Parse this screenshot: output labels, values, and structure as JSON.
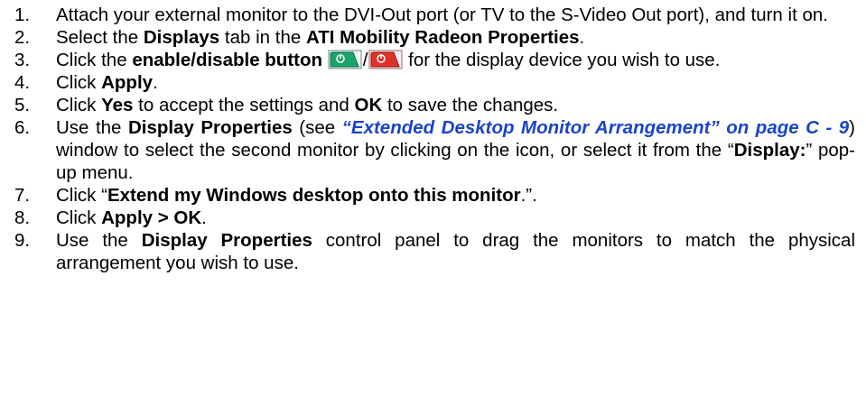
{
  "steps": [
    {
      "num": "1.",
      "t1": "Attach your external monitor to the DVI-Out port (or TV to the S-Video Out port), and turn it on."
    },
    {
      "num": "2.",
      "t1": "Select the ",
      "b1": "Displays",
      "t2": " tab in the ",
      "b2": "ATI Mobility Radeon Properties",
      "t3": "."
    },
    {
      "num": "3.",
      "t1": "Click the ",
      "b1": "enable/disable button",
      "sep": "/",
      "t2": " for the display device you wish to use."
    },
    {
      "num": "4.",
      "t1": "Click ",
      "b1": "Apply",
      "t2": "."
    },
    {
      "num": "5.",
      "t1": "Click ",
      "b1": "Yes",
      "t2": " to accept the settings and ",
      "b2": "OK",
      "t3": " to save the changes."
    },
    {
      "num": "6.",
      "t1": "Use the ",
      "b1": "Display Properties",
      "t2": " (see ",
      "link": "“Extended Desktop Monitor Arrangement” on page C - 9",
      "t3": ") window to select the second monitor by clicking on the icon, or select it from the “",
      "b2": "Display:",
      "t4": "” pop-up menu."
    },
    {
      "num": "7.",
      "t1": "Click “",
      "b1": "Extend my Windows desktop onto this monitor",
      "t2": ".”."
    },
    {
      "num": "8.",
      "t1": "Click ",
      "b1": "Apply > OK",
      "t2": "."
    },
    {
      "num": "9.",
      "t1": "Use the ",
      "b1": "Display Properties",
      "t2": " control panel to drag the monitors to match the physical arrangement you wish to use."
    }
  ],
  "icons": {
    "enable": {
      "name": "enable-button-icon",
      "color": "#1aa36a"
    },
    "disable": {
      "name": "disable-button-icon",
      "color": "#e03128"
    }
  }
}
